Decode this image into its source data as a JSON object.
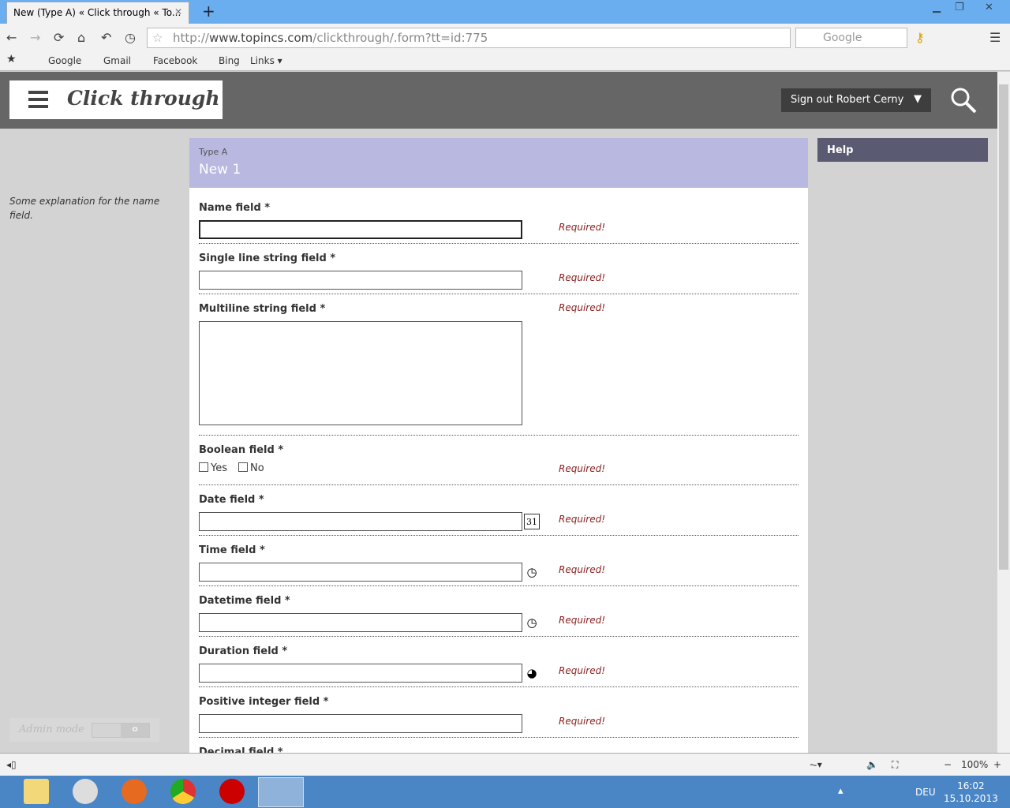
{
  "browser": {
    "tab_title": "New (Type A) « Click through « To...",
    "url_prefix": "http://",
    "url_domain": "www.topincs.com",
    "url_path": "/clickthrough/.form?tt=id:775",
    "search_placeholder": "Google",
    "bookmarks": [
      "Google",
      "Gmail",
      "Facebook",
      "Bing",
      "Links ▾"
    ],
    "zoom": "100%"
  },
  "header": {
    "title": "Click through",
    "signout": "Sign out Robert Cerny"
  },
  "sidebar": {
    "explanation": "Some explanation for the name field.",
    "admin_mode": "Admin mode"
  },
  "form": {
    "type": "Type A",
    "name": "New 1",
    "fields": [
      {
        "label": "Name field *",
        "kind": "text",
        "focus": true,
        "status": "Required!"
      },
      {
        "label": "Single line string field *",
        "kind": "text",
        "status": "Required!"
      },
      {
        "label": "Multiline string field *",
        "kind": "textarea",
        "status": "Required!"
      },
      {
        "label": "Boolean field *",
        "kind": "bool",
        "options": [
          "Yes",
          "No"
        ],
        "status": "Required!"
      },
      {
        "label": "Date field *",
        "kind": "date",
        "icon": "31",
        "status": "Required!"
      },
      {
        "label": "Time field *",
        "kind": "time",
        "icon": "◷",
        "status": "Required!"
      },
      {
        "label": "Datetime field *",
        "kind": "time",
        "icon": "◷",
        "status": "Required!"
      },
      {
        "label": "Duration field *",
        "kind": "time",
        "icon": "◕",
        "status": "Required!"
      },
      {
        "label": "Positive integer field *",
        "kind": "text",
        "status": "Required!"
      },
      {
        "label": "Decimal field *",
        "kind": "text",
        "status": ""
      }
    ]
  },
  "help": {
    "label": "Help"
  },
  "taskbar": {
    "lang": "DEU",
    "time": "16:02",
    "date": "15.10.2013"
  }
}
